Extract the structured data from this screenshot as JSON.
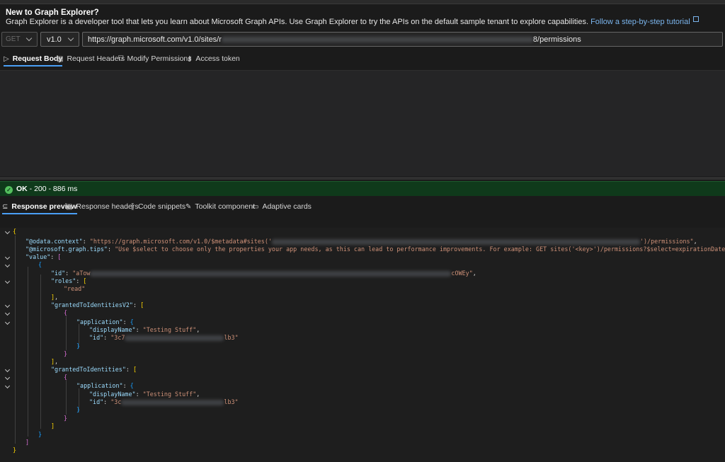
{
  "banner": {
    "title": "New to Graph Explorer?",
    "text": "Graph Explorer is a developer tool that lets you learn about Microsoft Graph APIs. Use Graph Explorer to try the APIs on the default sample tenant to explore capabilities.",
    "link": "Follow a step-by-step tutorial"
  },
  "query": {
    "method": "GET",
    "version": "v1.0",
    "url_prefix": "https://graph.microsoft.com/v1.0/sites/r",
    "url_suffix": "8/permissions"
  },
  "request_tabs": [
    "Request Body",
    "Request Headers",
    "Modify Permissions",
    "Access token"
  ],
  "status": {
    "ok": "OK",
    "detail": " - 200 - 886 ms"
  },
  "response_tabs": [
    "Response preview",
    "Response headers",
    "Code snippets",
    "Toolkit component",
    "Adaptive cards"
  ],
  "json": {
    "context_key": "\"@odata.context\"",
    "context_pre": "\"https://graph.microsoft.com/v1.0/$metadata#sites('",
    "context_post": "')/permissions\"",
    "tips_key": "\"@microsoft.graph.tips\"",
    "tips_val": "\"Use $select to choose only the properties your app needs, as this can lead to performance improvements. For example: GET sites('<key>')/permissions?$select=expirationDateTime,grantedTo\"",
    "value_key": "\"value\"",
    "id_key": "\"id\"",
    "id_pre": "\"aTow",
    "id_post": "cOWEy\"",
    "roles_key": "\"roles\"",
    "role_read": "\"read\"",
    "gtiv2_key": "\"grantedToIdentitiesV2\"",
    "gti_key": "\"grantedToIdentities\"",
    "application_key": "\"application\"",
    "display_name_key": "\"displayName\"",
    "display_name_val": "\"Testing Stuff\"",
    "app_id_pre_1": "\"3c7",
    "app_id_pre_2": "\"3c",
    "app_id_post": "lb3\""
  }
}
